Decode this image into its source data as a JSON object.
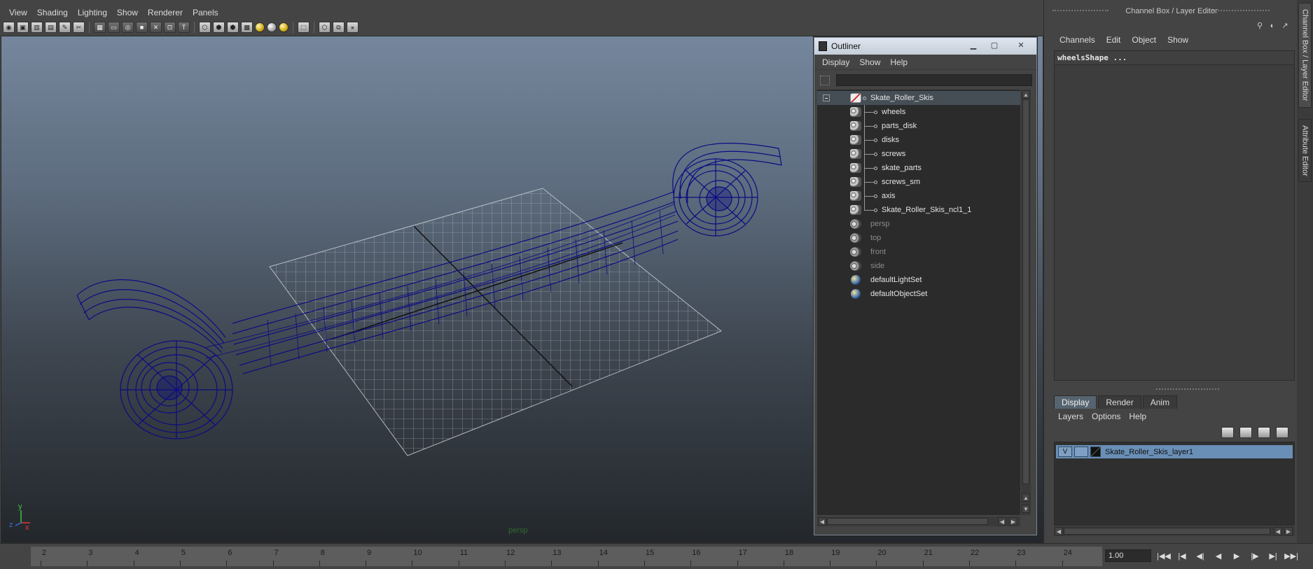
{
  "viewport": {
    "menu": [
      "View",
      "Shading",
      "Lighting",
      "Show",
      "Renderer",
      "Panels"
    ],
    "camera_label": "persp",
    "axis": {
      "x": "x",
      "y": "y",
      "z": "z"
    }
  },
  "outliner": {
    "title": "Outliner",
    "menu": [
      "Display",
      "Show",
      "Help"
    ],
    "filter_value": "",
    "items": [
      {
        "label": "Skate_Roller_Skis",
        "type": "group",
        "selected": true,
        "dim": false
      },
      {
        "label": "wheels",
        "type": "mesh",
        "child": true,
        "dim": false
      },
      {
        "label": "parts_disk",
        "type": "mesh",
        "child": true,
        "dim": false
      },
      {
        "label": "disks",
        "type": "mesh",
        "child": true,
        "dim": false
      },
      {
        "label": "screws",
        "type": "mesh",
        "child": true,
        "dim": false
      },
      {
        "label": "skate_parts",
        "type": "mesh",
        "child": true,
        "dim": false
      },
      {
        "label": "screws_sm",
        "type": "mesh",
        "child": true,
        "dim": false
      },
      {
        "label": "axis",
        "type": "mesh",
        "child": true,
        "dim": false
      },
      {
        "label": "Skate_Roller_Skis_ncl1_1",
        "type": "mesh",
        "child": true,
        "dim": false
      },
      {
        "label": "persp",
        "type": "camera",
        "dim": true
      },
      {
        "label": "top",
        "type": "camera",
        "dim": true
      },
      {
        "label": "front",
        "type": "camera",
        "dim": true
      },
      {
        "label": "side",
        "type": "camera",
        "dim": true
      },
      {
        "label": "defaultLightSet",
        "type": "set",
        "dim": false
      },
      {
        "label": "defaultObjectSet",
        "type": "set",
        "dim": false
      }
    ]
  },
  "channel_box": {
    "title": "Channel Box / Layer Editor",
    "menu": [
      "Channels",
      "Edit",
      "Object",
      "Show"
    ],
    "object_name": "wheelsShape ..."
  },
  "layer_editor": {
    "tabs": [
      "Display",
      "Render",
      "Anim"
    ],
    "active_tab": "Display",
    "menu": [
      "Layers",
      "Options",
      "Help"
    ],
    "layers": [
      {
        "visible": "V",
        "name": "Skate_Roller_Skis_layer1"
      }
    ]
  },
  "side_tabs": [
    "Channel Box / Layer Editor",
    "Attribute Editor"
  ],
  "time_slider": {
    "ticks": [
      2,
      3,
      4,
      5,
      6,
      7,
      8,
      9,
      10,
      11,
      12,
      13,
      14,
      15,
      16,
      17,
      18,
      19,
      20,
      21,
      22,
      23,
      24
    ],
    "current_time": "1.00"
  },
  "colors": {
    "wireframe": "#0a0a7a",
    "grid": "#c9ced4",
    "selection": "#6a8fb6"
  }
}
